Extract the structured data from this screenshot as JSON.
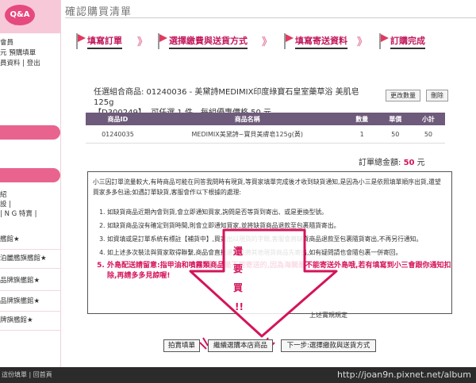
{
  "sidebar": {
    "badge": "Q&A",
    "links": [
      "會員",
      "元  預購填單",
      "員資料 | 登出"
    ],
    "menu_links": [
      "紹",
      "設 |",
      "| N G 特賣 |"
    ],
    "rows": [
      "艦館★",
      "泊麗艦旗艦館★",
      "品牌旗艦館★",
      "品牌旗艦館★",
      "牌旗艦館★"
    ]
  },
  "header": {
    "title": "確認購買清單"
  },
  "steps": [
    {
      "label": "填寫訂單"
    },
    {
      "label": "選擇繳費與送貨方式"
    },
    {
      "label": "填寫寄送資料"
    },
    {
      "label": "訂購完成"
    }
  ],
  "product": {
    "line1": "任選組合商品: 01240036 - 美黛詩MEDIMIX印度綠寶石皇室藥草浴 美肌皂125g",
    "line2": "【D300249】, 可任選 1 件、每組優惠價格 50 元",
    "edit_qty_label": "更改數量",
    "delete_label": "刪除"
  },
  "table": {
    "headers": [
      "商品ID",
      "商品名稱",
      "數量",
      "單價",
      "小計"
    ],
    "rows": [
      [
        "01240035",
        "MEDIMIX美黛詩~寶貝美膚皂125g(黃)",
        "1",
        "50",
        "50"
      ]
    ]
  },
  "total": {
    "label": "訂單總金額:",
    "amount": "50",
    "unit": "元"
  },
  "notice": {
    "intro": "小三因訂單流量較大,有時商品可能在同答我問時有現貨,等買家填單完成後才收到缺貨通知,是因為小三是依照填單順序出貨,還望買家多多包涵;如遇訂單缺貨,客服會作以下根據的處理:",
    "items": [
      "如缺貨商品近期內會到貨,會立即通知買家,詢問是否等貨到寄出、或是更換型號。",
      "如缺貨商品沒有確定到貨時間,則會立即通知買家,並將缺貨商品退款至包裹隨貨寄出。",
      "如資填或是訂單系統有標註【補貨中】,買家出以現貨的字眼,客服會將缺貨商品退款至包裹隨貨寄出,不再另行通知。",
      "如上述多次裝法與買家取得聯繫,商品會直接退款並將其他現貨商品先寄出,如有疑問請也會隨包裹一併寄回。",
      "外島配送請留意:指甲油和噴霧類商品是不能寄送的,因為海關是不能寄送外島哦,若有填寫到小三會跟你通知扣除,再請多多見諒喔!"
    ],
    "foot": "上述實規規定"
  },
  "annotation": {
    "chars": [
      "還",
      "要",
      "買",
      "!!"
    ]
  },
  "buttons": {
    "back": "拍賣填單",
    "continue": "繼續選購本店商品",
    "next": "下一步:選擇繳款與送貨方式"
  },
  "status": {
    "left": "這份填單 | 回首頁",
    "url": "http://joan9n.pixnet.net/album"
  },
  "colors": {
    "accent": "#d4145a",
    "table_header": "#6e5a7a",
    "sidebar_pink": "#e8648f"
  }
}
